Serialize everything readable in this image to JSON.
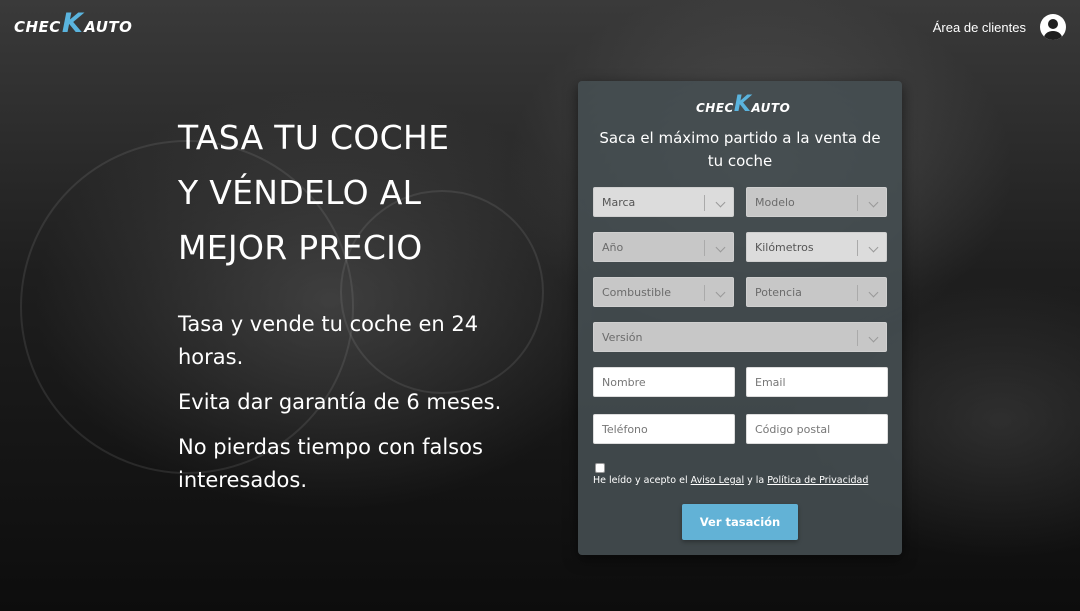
{
  "brand": {
    "left": "CHEC",
    "k": "K",
    "right": "AUTO"
  },
  "header": {
    "client_area": "Área de clientes",
    "avatar_icon": "user-circle-icon"
  },
  "hero": {
    "title_lines": [
      "TASA TU COCHE",
      "Y VÉNDELO AL",
      "MEJOR PRECIO"
    ],
    "benefits": [
      "Tasa y vende tu coche en 24 horas.",
      "Evita dar garantía de 6 meses.",
      "No pierdas tiempo con falsos interesados."
    ]
  },
  "form": {
    "heading": "Saca el máximo partido a la venta de tu coche",
    "selects": {
      "marca": "Marca",
      "modelo": "Modelo",
      "anio": "Año",
      "kilometros": "Kilómetros",
      "combustible": "Combustible",
      "potencia": "Potencia",
      "version": "Versión"
    },
    "inputs": {
      "nombre": "Nombre",
      "email": "Email",
      "telefono": "Teléfono",
      "codigo_postal": "Código postal"
    },
    "legal": {
      "prefix": "He leído y acepto el",
      "aviso": "Aviso Legal",
      "middle": "y la",
      "privacidad": "Política de Privacidad"
    },
    "submit": "Ver tasación"
  },
  "colors": {
    "accent": "#5ab4de",
    "button": "#62b2d6",
    "card": "#464e52"
  }
}
